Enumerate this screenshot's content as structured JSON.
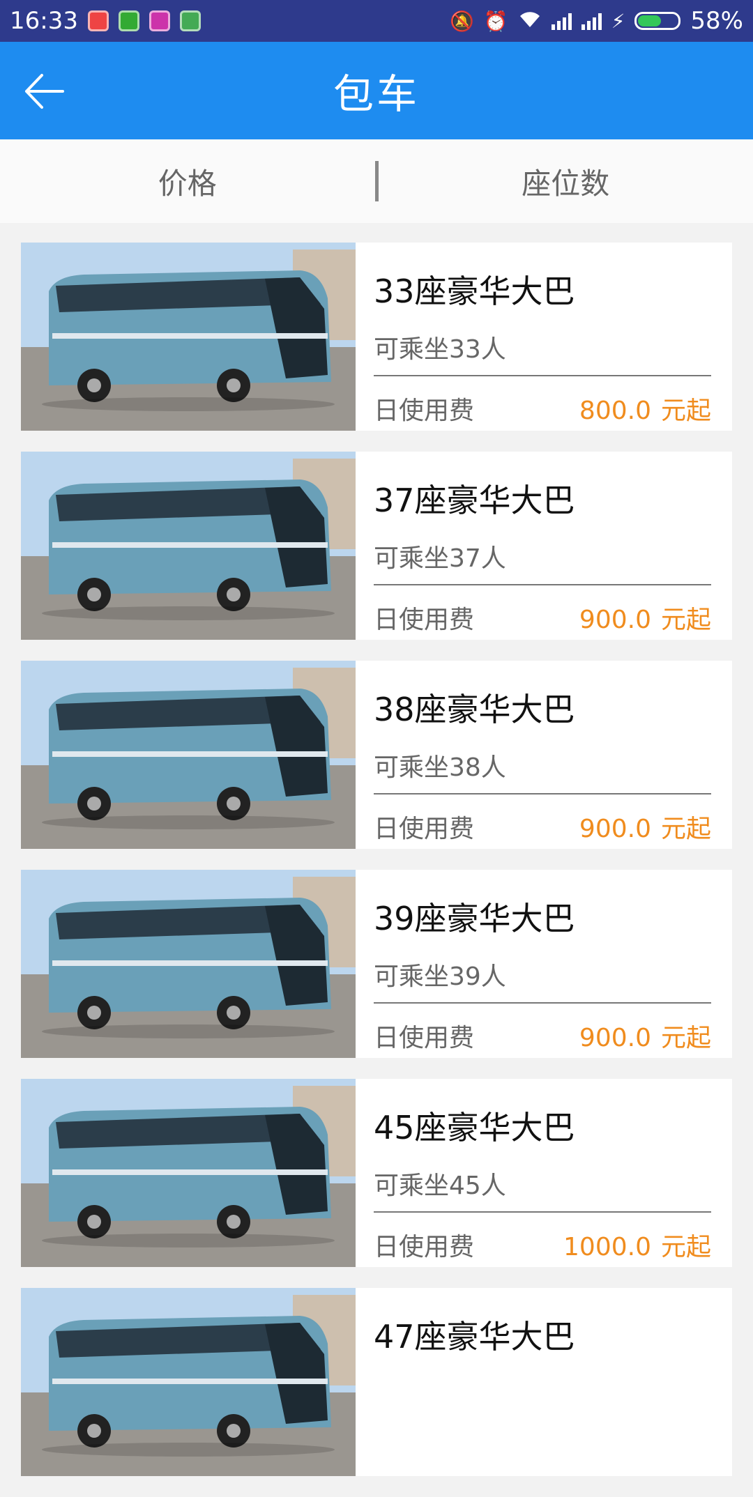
{
  "status_bar": {
    "time": "16:33",
    "battery_percent": "58%",
    "battery_level": 0.58
  },
  "app_bar": {
    "back_icon": "arrow-left-icon",
    "title": "包车"
  },
  "sort_bar": {
    "tabs": [
      {
        "label": "价格"
      },
      {
        "label": "座位数"
      }
    ]
  },
  "buses": [
    {
      "name": "33座豪华大巴",
      "capacity": "可乘坐33人",
      "fee_label": "日使用费",
      "price": "800.0",
      "price_suffix": "元起"
    },
    {
      "name": "37座豪华大巴",
      "capacity": "可乘坐37人",
      "fee_label": "日使用费",
      "price": "900.0",
      "price_suffix": "元起"
    },
    {
      "name": "38座豪华大巴",
      "capacity": "可乘坐38人",
      "fee_label": "日使用费",
      "price": "900.0",
      "price_suffix": "元起"
    },
    {
      "name": "39座豪华大巴",
      "capacity": "可乘坐39人",
      "fee_label": "日使用费",
      "price": "900.0",
      "price_suffix": "元起"
    },
    {
      "name": "45座豪华大巴",
      "capacity": "可乘坐45人",
      "fee_label": "日使用费",
      "price": "1000.0",
      "price_suffix": "元起"
    },
    {
      "name": "47座豪华大巴",
      "capacity": "",
      "fee_label": "",
      "price": "",
      "price_suffix": ""
    }
  ],
  "colors": {
    "status_bar": "#2e3a8c",
    "app_bar": "#1e8cf0",
    "price": "#f08c1e"
  }
}
